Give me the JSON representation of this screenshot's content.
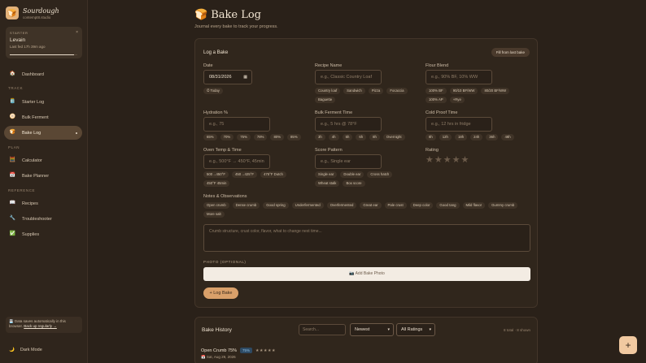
{
  "brand": {
    "name": "Sourdough",
    "sub": "contempt8.studio",
    "logo_icon": "bread-icon"
  },
  "starter": {
    "section_label": "STARTER",
    "close": "×",
    "name": "Levain",
    "last_fed": "Last fed 17h 39m ago",
    "progress_fraction": 0.95
  },
  "nav": {
    "dashboard": "Dashboard",
    "track_label": "TRACK",
    "starter_log": "Starter Log",
    "bulk_ferment": "Bulk Ferment",
    "bake_log": "Bake Log",
    "plan_label": "PLAN",
    "calculator": "Calculator",
    "bake_planner": "Bake Planner",
    "reference_label": "REFERENCE",
    "recipes": "Recipes",
    "troubleshooter": "Troubleshooter",
    "supplies": "Supplies"
  },
  "save_note": {
    "text": "💾 Data saves automatically in this browser.",
    "link": "Back up regularly →"
  },
  "dark_mode": "Dark Mode",
  "page": {
    "title": "Bake Log",
    "subtitle": "Journal every bake to track your progress."
  },
  "form": {
    "title": "Log a Bake",
    "fill_button": "Fill from last bake",
    "date": {
      "label": "Date",
      "value": "08/31/2026",
      "today": "⏱ Today"
    },
    "recipe": {
      "label": "Recipe Name",
      "placeholder": "e.g., Classic Country Loaf",
      "chips": [
        "Country loaf",
        "Sandwich",
        "Pizza",
        "Focaccia",
        "Baguette"
      ]
    },
    "flour": {
      "label": "Flour Blend",
      "placeholder": "e.g., 90% BF, 10% WW",
      "chips": [
        "100% BF",
        "90/10 BF/WW",
        "80/20 BF/WW",
        "100% AP",
        "+Rye"
      ]
    },
    "hydration": {
      "label": "Hydration %",
      "placeholder": "e.g., 75",
      "chips": [
        "65%",
        "70%",
        "75%",
        "78%",
        "80%",
        "85%"
      ]
    },
    "bulk": {
      "label": "Bulk Ferment Time",
      "placeholder": "e.g., 5 hrs @ 78°F",
      "chips": [
        "3h",
        "4h",
        "5h",
        "6h",
        "8h",
        "Overnight"
      ]
    },
    "cold": {
      "label": "Cold Proof Time",
      "placeholder": "e.g., 12 hrs in fridge",
      "chips": [
        "8h",
        "12h",
        "18h",
        "24h",
        "36h",
        "48h"
      ]
    },
    "oven": {
      "label": "Oven Temp & Time",
      "placeholder": "e.g., 500°F → 450°F, 45min",
      "chips": [
        "500→450°F",
        "450→425°F",
        "475°F Dutch",
        "450°F 45min"
      ]
    },
    "score": {
      "label": "Score Pattern",
      "placeholder": "e.g., Single ear",
      "chips": [
        "Single ear",
        "Double ear",
        "Cross hatch",
        "Wheat stalk",
        "Box score"
      ]
    },
    "rating": {
      "label": "Rating",
      "stars": "★★★★★",
      "value": 0
    },
    "notes": {
      "label": "Notes & Observations",
      "chips": [
        "Open crumb",
        "Dense crumb",
        "Good spring",
        "Underfermented",
        "Overfermented",
        "Great ear",
        "Pale crust",
        "Deep color",
        "Good tang",
        "Mild flavor",
        "Gummy crumb",
        "More salt"
      ],
      "placeholder": "Crumb structure, crust color, flavor, what to change next time..."
    },
    "photo_label": "PHOTO (OPTIONAL)",
    "photo_button": "📷 Add Bake Photo",
    "submit": "+ Log Bake"
  },
  "history": {
    "title": "Bake History",
    "search_placeholder": "Search...",
    "sort": "Newest",
    "filter": "All Ratings",
    "count": "8 total · 8 shown",
    "entry": {
      "name": "Open Crumb 75%",
      "badge": "75%",
      "stars": "★★★★★",
      "date": "📅 Sat, Aug 29, 2026"
    }
  },
  "fab": "+"
}
